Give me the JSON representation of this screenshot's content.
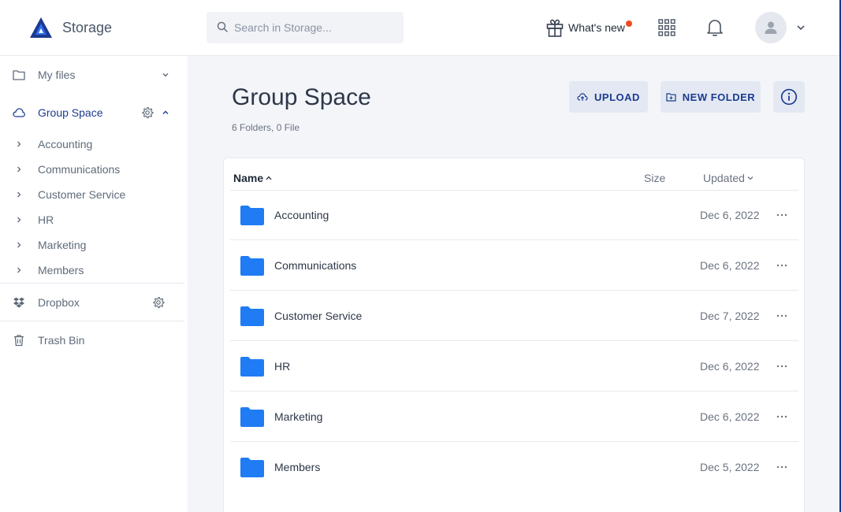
{
  "app": {
    "title": "Storage"
  },
  "search": {
    "placeholder": "Search in Storage..."
  },
  "header": {
    "whats_new_label": "What's new",
    "notification_dot_color": "#f04b23"
  },
  "colors": {
    "brand": "#1b3b8f",
    "folder": "#1f7cf5",
    "main_bg": "#f3f5f9",
    "button_bg": "#e3e8f3"
  },
  "sidebar": {
    "my_files": "My files",
    "group_space": "Group Space",
    "group_children": [
      "Accounting",
      "Communications",
      "Customer Service",
      "HR",
      "Marketing",
      "Members"
    ],
    "dropbox": "Dropbox",
    "trash": "Trash Bin"
  },
  "main": {
    "title": "Group Space",
    "subtitle": "6 Folders, 0 File",
    "upload_label": "UPLOAD",
    "new_folder_label": "NEW FOLDER",
    "columns": {
      "name": "Name",
      "size": "Size",
      "updated": "Updated"
    },
    "rows": [
      {
        "name": "Accounting",
        "size": "",
        "updated": "Dec 6, 2022"
      },
      {
        "name": "Communications",
        "size": "",
        "updated": "Dec 6, 2022"
      },
      {
        "name": "Customer Service",
        "size": "",
        "updated": "Dec 7, 2022"
      },
      {
        "name": "HR",
        "size": "",
        "updated": "Dec 6, 2022"
      },
      {
        "name": "Marketing",
        "size": "",
        "updated": "Dec 6, 2022"
      },
      {
        "name": "Members",
        "size": "",
        "updated": "Dec 5, 2022"
      }
    ]
  },
  "icons": {
    "logo": "triangle-logo-icon",
    "search": "search-icon",
    "gift": "gift-icon",
    "apps": "apps-grid-icon",
    "bell": "bell-icon",
    "user": "user-icon",
    "folder": "folder-icon",
    "more": "more-horizontal-icon"
  }
}
